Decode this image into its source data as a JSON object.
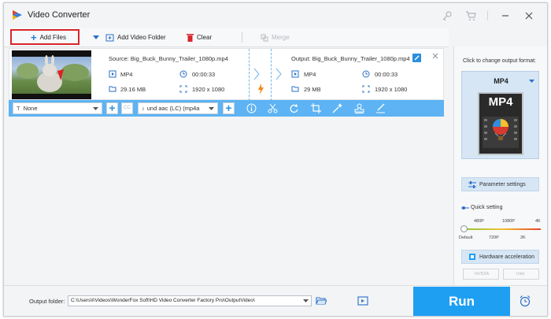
{
  "window": {
    "title": "Video Converter",
    "icons": [
      "app-logo-icon",
      "key-icon",
      "cart-icon",
      "minimize-icon",
      "close-icon"
    ]
  },
  "toolbar": {
    "add_files": "Add Files",
    "add_video_folder": "Add Video Folder",
    "clear": "Clear",
    "merge": "Merge"
  },
  "file": {
    "source_label": "Source: Big_Buck_Bunny_Trailer_1080p.mp4",
    "output_label": "Output: Big_Buck_Bunny_Trailer_1080p.mp4",
    "source": {
      "format": "MP4",
      "duration": "00:00:33",
      "size": "29.16 MB",
      "resolution": "1920 x 1080"
    },
    "output": {
      "format": "MP4",
      "duration": "00:00:33",
      "size": "29 MB",
      "resolution": "1920 x 1080"
    }
  },
  "editbar": {
    "subtitle": "None",
    "audio": "und aac (LC) (mp4a"
  },
  "right_panel": {
    "title": "Click to change output format:",
    "format": "MP4",
    "format_badge": "MP4",
    "parameter_settings": "Parameter settings",
    "quick_setting": "Quick setting",
    "quality_top": [
      "480P",
      "1080P",
      "4K"
    ],
    "quality_bottom": [
      "Default",
      "720P",
      "2K"
    ],
    "hardware_acceleration": "Hardware acceleration",
    "nvidia": "NVIDIA",
    "intel": "Intel"
  },
  "bottom": {
    "output_folder_label": "Output folder:",
    "output_folder_path": "C:\\Users\\l\\Videos\\WonderFox Soft\\HD Video Converter Factory Pro\\OutputVideo\\",
    "run": "Run"
  },
  "colors": {
    "accent": "#1e9ff2",
    "editbar": "#5db3f3",
    "highlight": "#d8262b"
  }
}
